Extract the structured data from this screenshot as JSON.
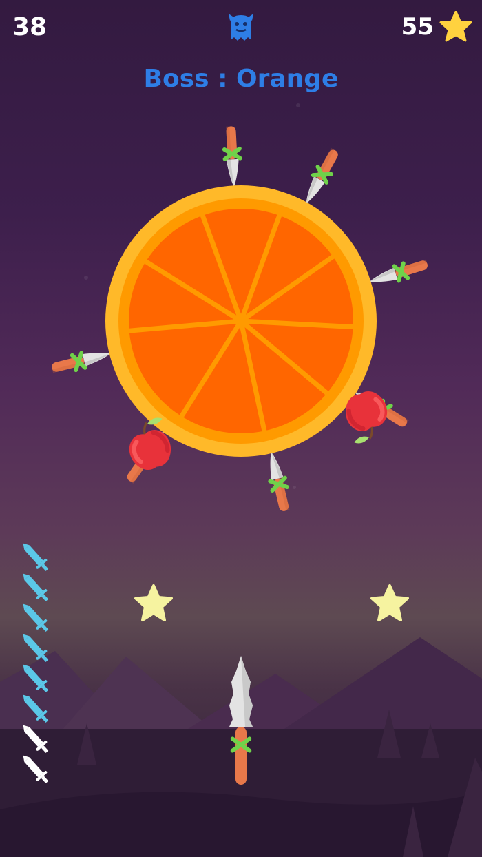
{
  "hud": {
    "score": "38",
    "star_count": "55"
  },
  "boss": {
    "title": "Boss : Orange",
    "target_fruit": "orange"
  },
  "icons": {
    "boss": "monster-icon",
    "currency": "star-icon",
    "knife": "knife-icon",
    "apple": "apple-icon"
  },
  "knives_remaining": {
    "total": 8,
    "used": 6,
    "remaining": 2
  },
  "target": {
    "stuck_knives": 7,
    "stuck_apples": 2
  },
  "pickups": {
    "floating_stars": 2
  },
  "colors": {
    "accent": "#2e7ee6",
    "orange_rind": "#ffb929",
    "orange_pith": "#ff9a00",
    "orange_flesh": "#ff6600",
    "knife_used": "#5bc8e8",
    "knife_available": "#ffffff",
    "handle": "#e8784a",
    "wrap": "#6fd24a",
    "star_gold": "#ffd23f",
    "star_pale": "#f6f3a0"
  }
}
